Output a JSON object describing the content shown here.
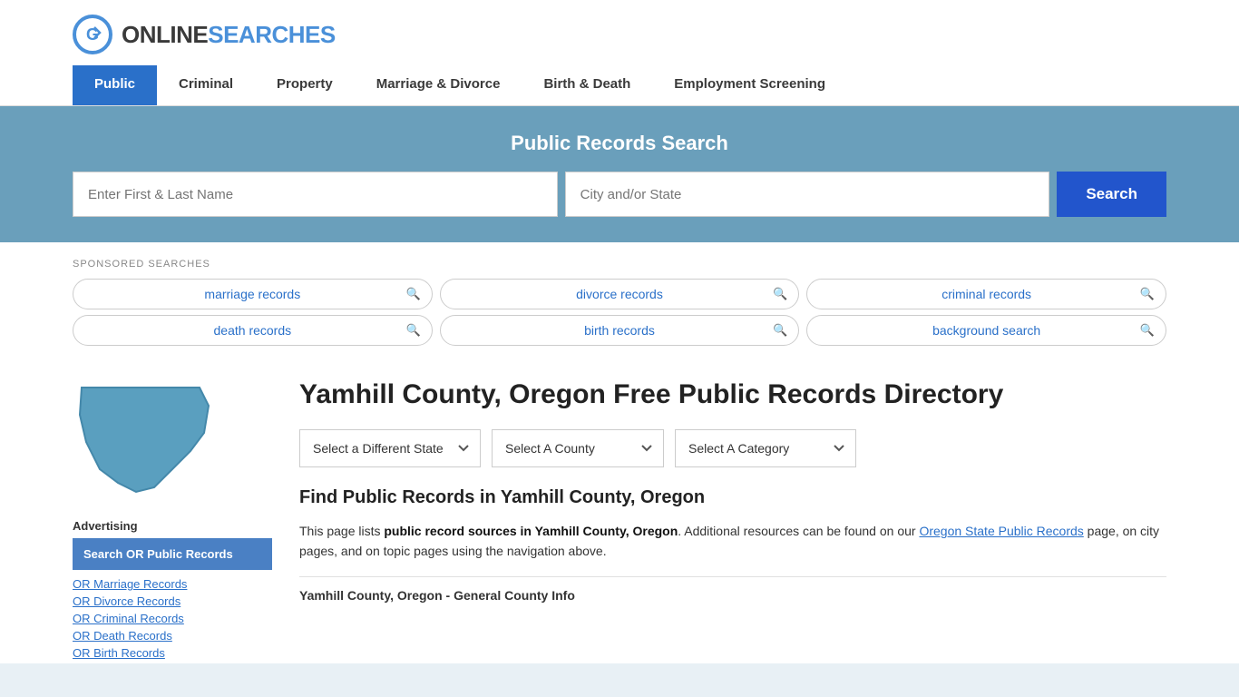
{
  "site": {
    "logo_text_online": "ONLINE",
    "logo_text_searches": "SEARCHES"
  },
  "nav": {
    "items": [
      {
        "id": "public",
        "label": "Public",
        "active": true
      },
      {
        "id": "criminal",
        "label": "Criminal",
        "active": false
      },
      {
        "id": "property",
        "label": "Property",
        "active": false
      },
      {
        "id": "marriage-divorce",
        "label": "Marriage & Divorce",
        "active": false
      },
      {
        "id": "birth-death",
        "label": "Birth & Death",
        "active": false
      },
      {
        "id": "employment",
        "label": "Employment Screening",
        "active": false
      }
    ]
  },
  "search_banner": {
    "title": "Public Records Search",
    "name_placeholder": "Enter First & Last Name",
    "location_placeholder": "City and/or State",
    "button_label": "Search"
  },
  "sponsored": {
    "label": "SPONSORED SEARCHES",
    "tags": [
      "marriage records",
      "divorce records",
      "criminal records",
      "death records",
      "birth records",
      "background search"
    ]
  },
  "sidebar": {
    "advertising_label": "Advertising",
    "featured_link": "Search OR Public Records",
    "links": [
      "OR Marriage Records",
      "OR Divorce Records",
      "OR Criminal Records",
      "OR Death Records",
      "OR Birth Records"
    ]
  },
  "main": {
    "page_title": "Yamhill County, Oregon Free Public Records Directory",
    "selects": {
      "state_label": "Select a Different State",
      "county_label": "Select A County",
      "category_label": "Select A Category"
    },
    "find_title": "Find Public Records in Yamhill County, Oregon",
    "description": "This page lists public record sources in Yamhill County, Oregon. Additional resources can be found on our Oregon State Public Records page, on city pages, and on topic pages using the navigation above.",
    "description_link_text": "Oregon State Public Records",
    "county_info_label": "Yamhill County, Oregon - General County Info"
  }
}
